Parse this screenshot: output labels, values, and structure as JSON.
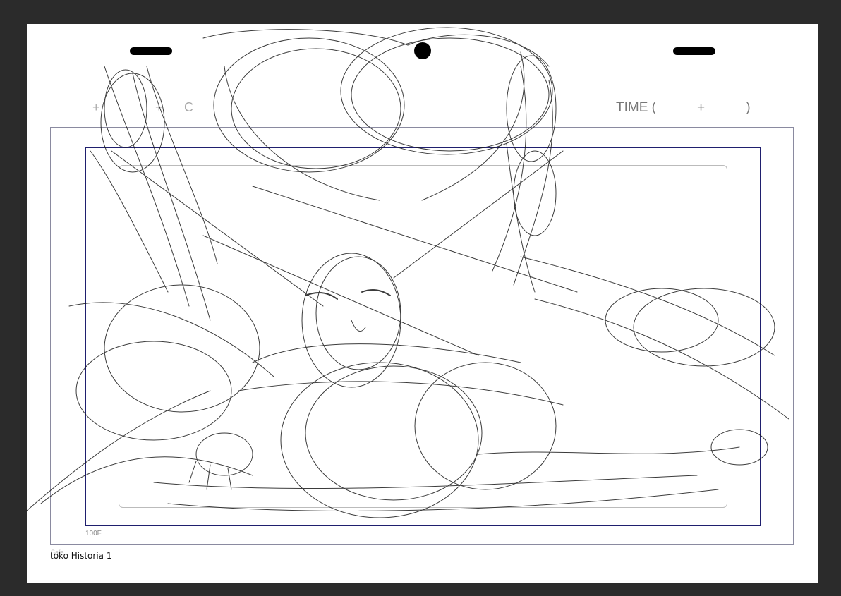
{
  "sheet": {
    "time_label": "TIME (           +           )",
    "frame_label": "100F",
    "safe_label": "Safe",
    "file_name": "toko Historia 1",
    "ghost_marks": [
      "+",
      "+",
      "C"
    ]
  },
  "colors": {
    "background": "#2b2b2b",
    "paper": "#ffffff",
    "frame_100": "#1f1f6e",
    "sketch_stroke": "#1a1a1a"
  },
  "icons": {
    "peg_holes": [
      "peg-slot",
      "peg-round-hole",
      "peg-slot"
    ]
  }
}
